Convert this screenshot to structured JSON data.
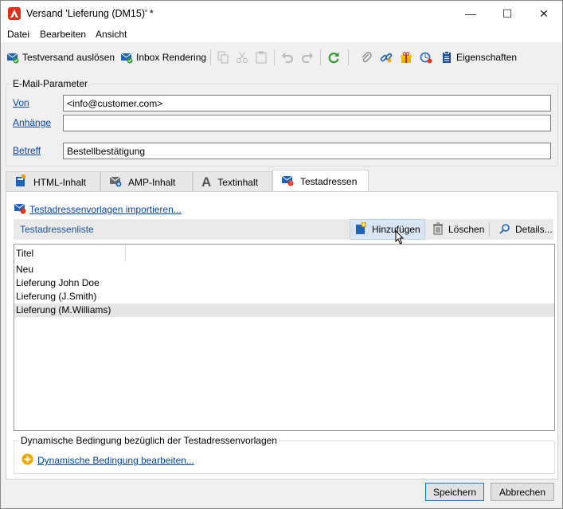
{
  "window": {
    "title": "Versand 'Lieferung (DM15)' *",
    "controls": {
      "minimize": "—",
      "maximize": "☐",
      "close": "✕"
    }
  },
  "menu": [
    "Datei",
    "Bearbeiten",
    "Ansicht"
  ],
  "toolbar": {
    "testversand_label": "Testversand auslösen",
    "inbox_rendering_label": "Inbox Rendering",
    "eigenschaften_label": "Eigenschaften"
  },
  "email_params": {
    "group_title": "E-Mail-Parameter",
    "von_label": "Von",
    "von_value": "<info@customer.com>",
    "anhaenge_label": "Anhänge",
    "anhaenge_value": "",
    "betreff_label": "Betreff",
    "betreff_value": "Bestellbestätigung"
  },
  "tabs": [
    {
      "label": "HTML-Inhalt"
    },
    {
      "label": "AMP-Inhalt"
    },
    {
      "label": "Textinhalt"
    },
    {
      "label": "Testadressen"
    }
  ],
  "testadressen": {
    "import_link": "Testadressenvorlagen importieren...",
    "list_title": "Testadressenliste",
    "add_label": "Hinzufügen",
    "delete_label": "Löschen",
    "details_label": "Details...",
    "column_header": "Titel",
    "rows": [
      "Neu",
      "Lieferung John Doe",
      "Lieferung (J.Smith)",
      "Lieferung (M.Williams)"
    ],
    "condition_group_title": "Dynamische Bedingung bezüglich der Testadressenvorlagen",
    "condition_link": "Dynamische Bedingung bearbeiten..."
  },
  "footer": {
    "save_label": "Speichern",
    "cancel_label": "Abbrechen"
  },
  "colors": {
    "accent": "#e0301e",
    "link": "#0645ad",
    "green": "#2e9b2e",
    "blue_icon": "#1e63b8"
  }
}
